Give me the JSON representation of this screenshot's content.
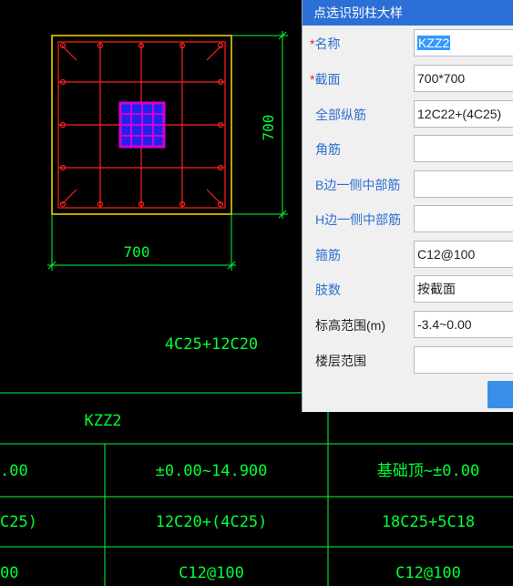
{
  "drawing": {
    "dim_width": "700",
    "dim_height": "700",
    "rebar_note": "4C25+12C20",
    "table_header": "KZZ2",
    "table_rows": [
      [
        ".00",
        "±0.00~14.900",
        "基础顶~±0.00"
      ],
      [
        "C25)",
        "12C20+(4C25)",
        "18C25+5C18"
      ],
      [
        "00",
        "C12@100",
        "C12@100"
      ]
    ],
    "colors": {
      "column_outline": "#ffd700",
      "rebar": "#ff2020",
      "dimension": "#00ff33",
      "core": "#2222ee",
      "core_border": "#d400d4"
    }
  },
  "dialog": {
    "title": "点选识别柱大样",
    "fields": [
      {
        "label": "名称",
        "required": true,
        "value": "KZZ2",
        "selected": true
      },
      {
        "label": "截面",
        "required": true,
        "value": "700*700"
      },
      {
        "label": "全部纵筋",
        "value": "12C22+(4C25)"
      },
      {
        "label": "角筋",
        "value": ""
      },
      {
        "label": "B边一侧中部筋",
        "value": ""
      },
      {
        "label": "H边一侧中部筋",
        "value": ""
      },
      {
        "label": "箍筋",
        "value": "C12@100"
      },
      {
        "label": "肢数",
        "value": "按截面"
      },
      {
        "label": "标高范围(m)",
        "value": "-3.4~0.00",
        "black": true
      },
      {
        "label": "楼层范围",
        "value": "",
        "black": true
      }
    ],
    "ok_button": {
      "color": "#3a8ee8"
    }
  }
}
